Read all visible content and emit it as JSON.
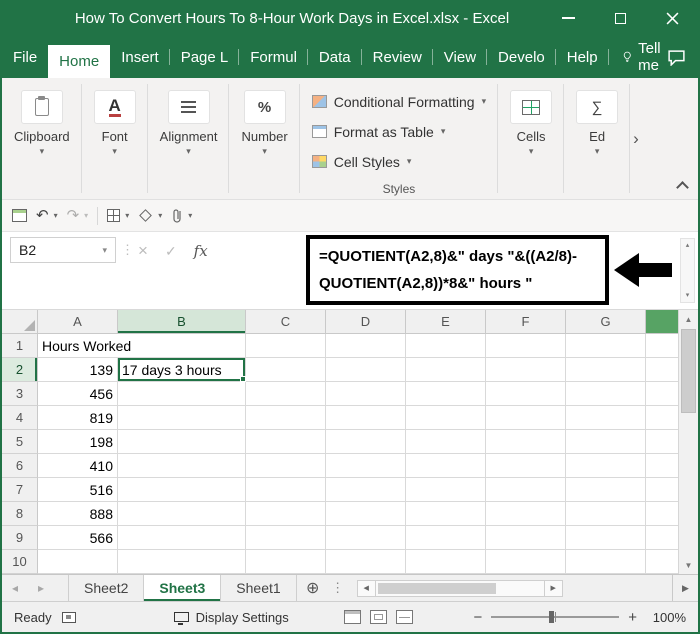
{
  "title_bar": {
    "title": "How To Convert Hours To 8-Hour Work Days in Excel.xlsx - Excel"
  },
  "menu_bar": {
    "items": [
      {
        "label": "File"
      },
      {
        "label": "Home"
      },
      {
        "label": "Insert"
      },
      {
        "label": "Page L"
      },
      {
        "label": "Formul"
      },
      {
        "label": "Data"
      },
      {
        "label": "Review"
      },
      {
        "label": "View"
      },
      {
        "label": "Develo"
      },
      {
        "label": "Help"
      }
    ],
    "tell_me_label": "Tell me"
  },
  "ribbon": {
    "groups": [
      {
        "label": "Clipboard"
      },
      {
        "label": "Font"
      },
      {
        "label": "Alignment"
      },
      {
        "label": "Number"
      }
    ],
    "styles_group": {
      "label": "Styles",
      "items": [
        "Conditional Formatting",
        "Format as Table",
        "Cell Styles"
      ]
    },
    "cells_group": {
      "label": "Cells"
    },
    "editing_group": {
      "label": "Ed"
    }
  },
  "formula_bar": {
    "name_box_value": "B2",
    "formula_line1": "=QUOTIENT(A2,8)&\" days \"&((A2/8)-",
    "formula_line2": "QUOTIENT(A2,8))*8&\" hours \""
  },
  "grid": {
    "column_headers": [
      "A",
      "B",
      "C",
      "D",
      "E",
      "F",
      "G"
    ],
    "row_headers": [
      "1",
      "2",
      "3",
      "4",
      "5",
      "6",
      "7",
      "8",
      "9",
      "10"
    ],
    "selected_cell": "B2",
    "cells": {
      "A1": "Hours Worked",
      "A2": "139",
      "A3": "456",
      "A4": "819",
      "A5": "198",
      "A6": "410",
      "A7": "516",
      "A8": "888",
      "A9": "566",
      "B2": "17 days 3 hours"
    }
  },
  "sheet_bar": {
    "tabs": [
      {
        "label": "Sheet2",
        "active": false
      },
      {
        "label": "Sheet3",
        "active": true
      },
      {
        "label": "Sheet1",
        "active": false
      }
    ]
  },
  "status_bar": {
    "mode": "Ready",
    "display_settings_label": "Display Settings",
    "zoom_level": "100%"
  },
  "icons": {
    "caret_down": "▾",
    "triangle_up": "▴",
    "undo": "↶",
    "redo": "↷",
    "kebab": "⋮",
    "plus_circle": "⊕",
    "check": "✓",
    "cancel_x": "×",
    "fx": "fx",
    "font_a": "A",
    "percent": "%",
    "sigma": "∑",
    "scroll_up": "▲",
    "scroll_down": "▼",
    "scroll_left": "◀",
    "scroll_right": "▶",
    "nav_left": "◂",
    "nav_right": "▸",
    "chevron_right": "›",
    "minus": "−",
    "plus": "+"
  }
}
